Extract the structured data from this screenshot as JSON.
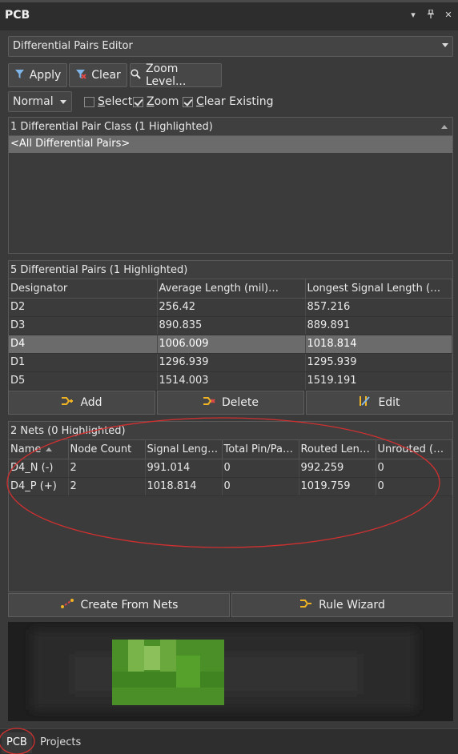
{
  "window": {
    "title": "PCB"
  },
  "mode_dropdown": {
    "value": "Differential Pairs Editor"
  },
  "toolbar": {
    "apply_label": "Apply",
    "clear_label": "Clear",
    "zoom_level_label": "Zoom Level..."
  },
  "filter_mode": {
    "value": "Normal"
  },
  "options": {
    "select_label": "Select",
    "select_checked": false,
    "zoom_label": "Zoom",
    "zoom_checked": true,
    "clear_existing_label": "Clear Existing",
    "clear_existing_checked": true
  },
  "classes": {
    "header": "1 Differential Pair Class (1 Highlighted)",
    "items": [
      {
        "label": "<All Differential Pairs>",
        "selected": true
      }
    ]
  },
  "pairs": {
    "header": "5 Differential Pairs (1 Highlighted)",
    "columns": [
      "Designator",
      "Average Length (mil)",
      "Longest Signal Length (mil)"
    ],
    "rows": [
      {
        "designator": "D2",
        "avg": "256.42",
        "longest": "857.216",
        "highlighted": false
      },
      {
        "designator": "D3",
        "avg": "890.835",
        "longest": "889.891",
        "highlighted": false
      },
      {
        "designator": "D4",
        "avg": "1006.009",
        "longest": "1018.814",
        "highlighted": true
      },
      {
        "designator": "D1",
        "avg": "1296.939",
        "longest": "1295.939",
        "highlighted": false
      },
      {
        "designator": "D5",
        "avg": "1514.003",
        "longest": "1519.191",
        "highlighted": false
      }
    ],
    "add_label": "Add",
    "delete_label": "Delete",
    "edit_label": "Edit"
  },
  "nets": {
    "header": "2 Nets (0 Highlighted)",
    "columns": [
      "Name",
      "Node Count",
      "Signal Lengt...",
      "Total Pin/Pac...",
      "Routed Leng...",
      "Unrouted (M..."
    ],
    "rows": [
      {
        "name": "D4_N (-)",
        "nodes": "2",
        "signal": "991.014",
        "pinpad": "0",
        "routed": "992.259",
        "unrouted": "0"
      },
      {
        "name": "D4_P (+)",
        "nodes": "2",
        "signal": "1018.814",
        "pinpad": "0",
        "routed": "1019.759",
        "unrouted": "0"
      }
    ]
  },
  "actions": {
    "create_from_nets_label": "Create From Nets",
    "rule_wizard_label": "Rule Wizard"
  },
  "tabs": [
    {
      "label": "PCB",
      "active": true
    },
    {
      "label": "Projects",
      "active": false
    }
  ],
  "colors": {
    "annotation": "#d03030",
    "preview_green": "#4f9a2a"
  }
}
